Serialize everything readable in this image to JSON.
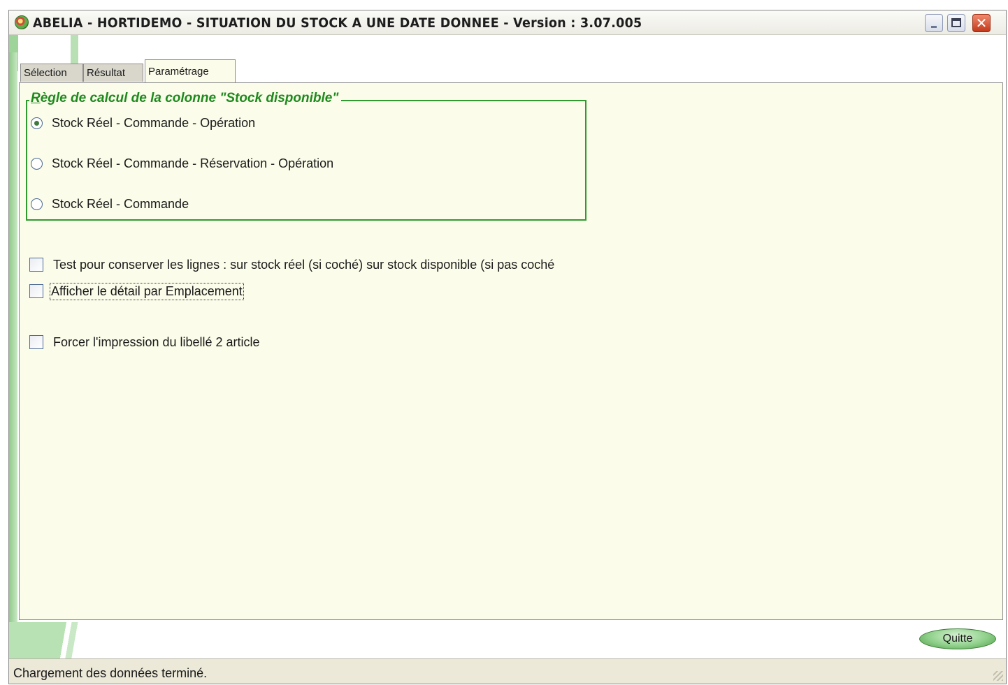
{
  "window": {
    "title": "ABELIA  -  HORTIDEMO  -  SITUATION DU STOCK A UNE DATE DONNEE  -  Version : 3.07.005",
    "controls": {
      "minimize": "minimize-icon",
      "maximize": "maximize-icon",
      "close": "close-icon"
    }
  },
  "tabs": [
    {
      "label": "Sélection"
    },
    {
      "label": "Résultat"
    },
    {
      "label": "Paramétrage",
      "active": true
    }
  ],
  "group": {
    "legend_prefix": "R",
    "legend_rest": "ègle de calcul de la colonne \"Stock disponible\"",
    "options": [
      {
        "label": "Stock Réel - Commande - Opération",
        "selected": true
      },
      {
        "label": "Stock Réel - Commande - Réservation - Opération",
        "selected": false
      },
      {
        "label": "Stock Réel - Commande",
        "selected": false
      }
    ]
  },
  "checks": [
    {
      "label": "Test pour conserver les lignes  : sur stock réel (si coché)  sur stock disponible (si pas coché",
      "checked": false
    },
    {
      "label": "Afficher le détail par Emplacement",
      "checked": false
    },
    {
      "label": "Forcer l'impression du libellé 2 article",
      "checked": false
    }
  ],
  "buttons": {
    "quit": "Quitte"
  },
  "status": {
    "text": "Chargement des données  terminé."
  },
  "colors": {
    "accent_green": "#1e8a1e",
    "panel_bg": "#fbfce9",
    "status_bg": "#ece9d8"
  }
}
